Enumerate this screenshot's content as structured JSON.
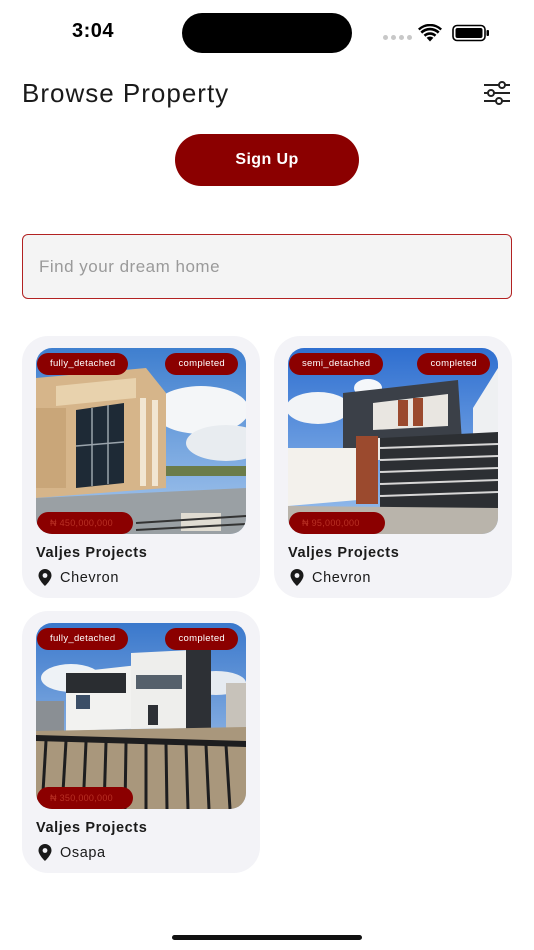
{
  "status_bar": {
    "time": "3:04"
  },
  "header": {
    "title": "Browse Property"
  },
  "signup": {
    "label": "Sign Up"
  },
  "search": {
    "placeholder": "Find your dream home"
  },
  "properties": [
    {
      "type": "fully_detached",
      "status": "completed",
      "price": "₦ 450,000,000",
      "title": "Valjes Projects",
      "location": "Chevron"
    },
    {
      "type": "semi_detached",
      "status": "completed",
      "price": "₦ 95,000,000",
      "title": "Valjes Projects",
      "location": "Chevron"
    },
    {
      "type": "fully_detached",
      "status": "completed",
      "price": "₦ 350,000,000",
      "title": "Valjes Projects",
      "location": "Osapa"
    }
  ],
  "colors": {
    "brand": "#8b0000",
    "search_border": "#b22222",
    "card_bg": "#f3f3f7"
  },
  "icons": [
    "wifi-icon",
    "battery-icon",
    "filter-icon",
    "map-pin-icon"
  ]
}
